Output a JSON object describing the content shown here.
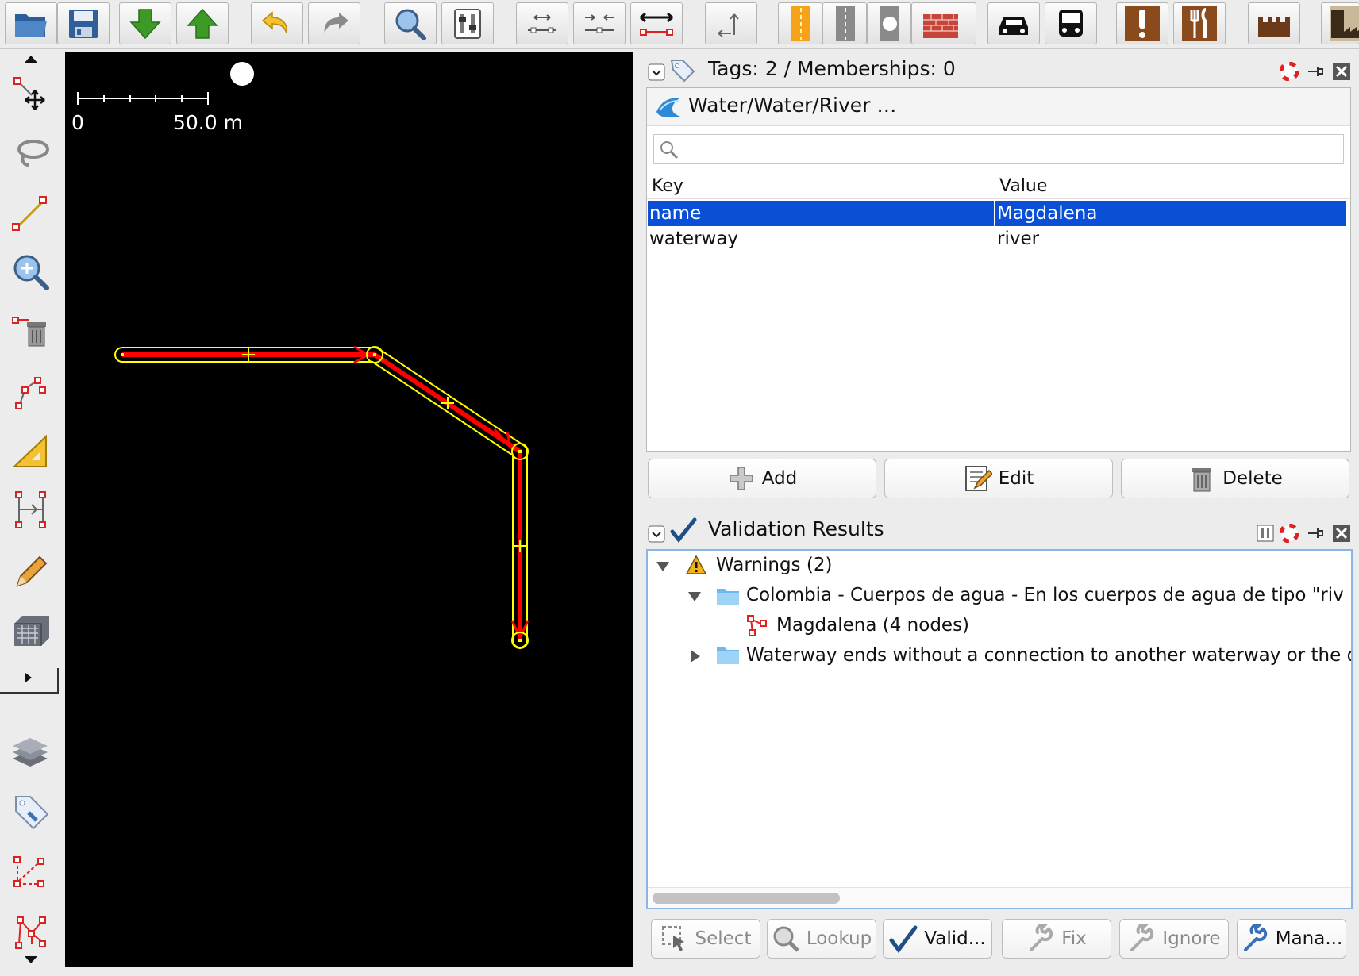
{
  "toolbar": {
    "buttons": [
      {
        "icon": "open-folder-icon"
      },
      {
        "icon": "save-icon"
      },
      {
        "icon": "download-icon"
      },
      {
        "icon": "upload-icon"
      },
      {
        "icon": "undo-icon"
      },
      {
        "icon": "redo-icon"
      },
      {
        "icon": "zoom-icon"
      },
      {
        "icon": "preferences-icon"
      },
      {
        "icon": "align-nodes-icon"
      },
      {
        "icon": "merge-nodes-icon"
      },
      {
        "icon": "split-way-icon"
      },
      {
        "icon": "reverse-way-icon"
      },
      {
        "icon": "road-preset-icon"
      },
      {
        "icon": "street-preset-icon"
      },
      {
        "icon": "roundabout-preset-icon"
      },
      {
        "icon": "wall-preset-icon"
      },
      {
        "icon": "car-preset-icon"
      },
      {
        "icon": "bus-preset-icon"
      },
      {
        "icon": "emergency-preset-icon"
      },
      {
        "icon": "restaurant-preset-icon"
      },
      {
        "icon": "castle-preset-icon"
      },
      {
        "icon": "industrial-preset-icon"
      }
    ]
  },
  "left_toolbar": {
    "tools": [
      "select-icon",
      "lasso-icon",
      "draw-icon",
      "zoom-tool-icon",
      "delete-tool-icon",
      "split-tool-icon",
      "measure-icon",
      "extrude-icon",
      "pencil-icon",
      "building-icon"
    ],
    "bottom_tools": [
      "layers-icon",
      "tags-icon",
      "relation-icon",
      "validator-icon"
    ]
  },
  "map": {
    "scale_zero": "0",
    "scale_label": "50.0 m"
  },
  "tags_panel": {
    "title": "Tags: 2 / Memberships: 0",
    "preset": "Water/Water/River …",
    "search_placeholder": "",
    "columns": {
      "key": "Key",
      "value": "Value"
    },
    "rows": [
      {
        "key": "name",
        "value": "Magdalena",
        "selected": true
      },
      {
        "key": "waterway",
        "value": "river",
        "selected": false
      }
    ],
    "buttons": {
      "add": "Add",
      "edit": "Edit",
      "delete": "Delete"
    }
  },
  "validation_panel": {
    "title": "Validation Results",
    "tree": {
      "warnings": "Warnings (2)",
      "group1": "Colombia - Cuerpos de agua - En los cuerpos de agua de tipo \"riv",
      "item1": "Magdalena (4 nodes)",
      "group2": "Waterway ends without a connection to another waterway or the di"
    },
    "buttons": {
      "select": "Select",
      "lookup": "Lookup",
      "validate": "Valid...",
      "fix": "Fix",
      "ignore": "Ignore",
      "manage": "Mana..."
    }
  },
  "colors": {
    "selection": "#0a4fd6",
    "way_highlight": "#ffff00",
    "way_line": "#ff0000",
    "accent": "#1f5fae"
  }
}
